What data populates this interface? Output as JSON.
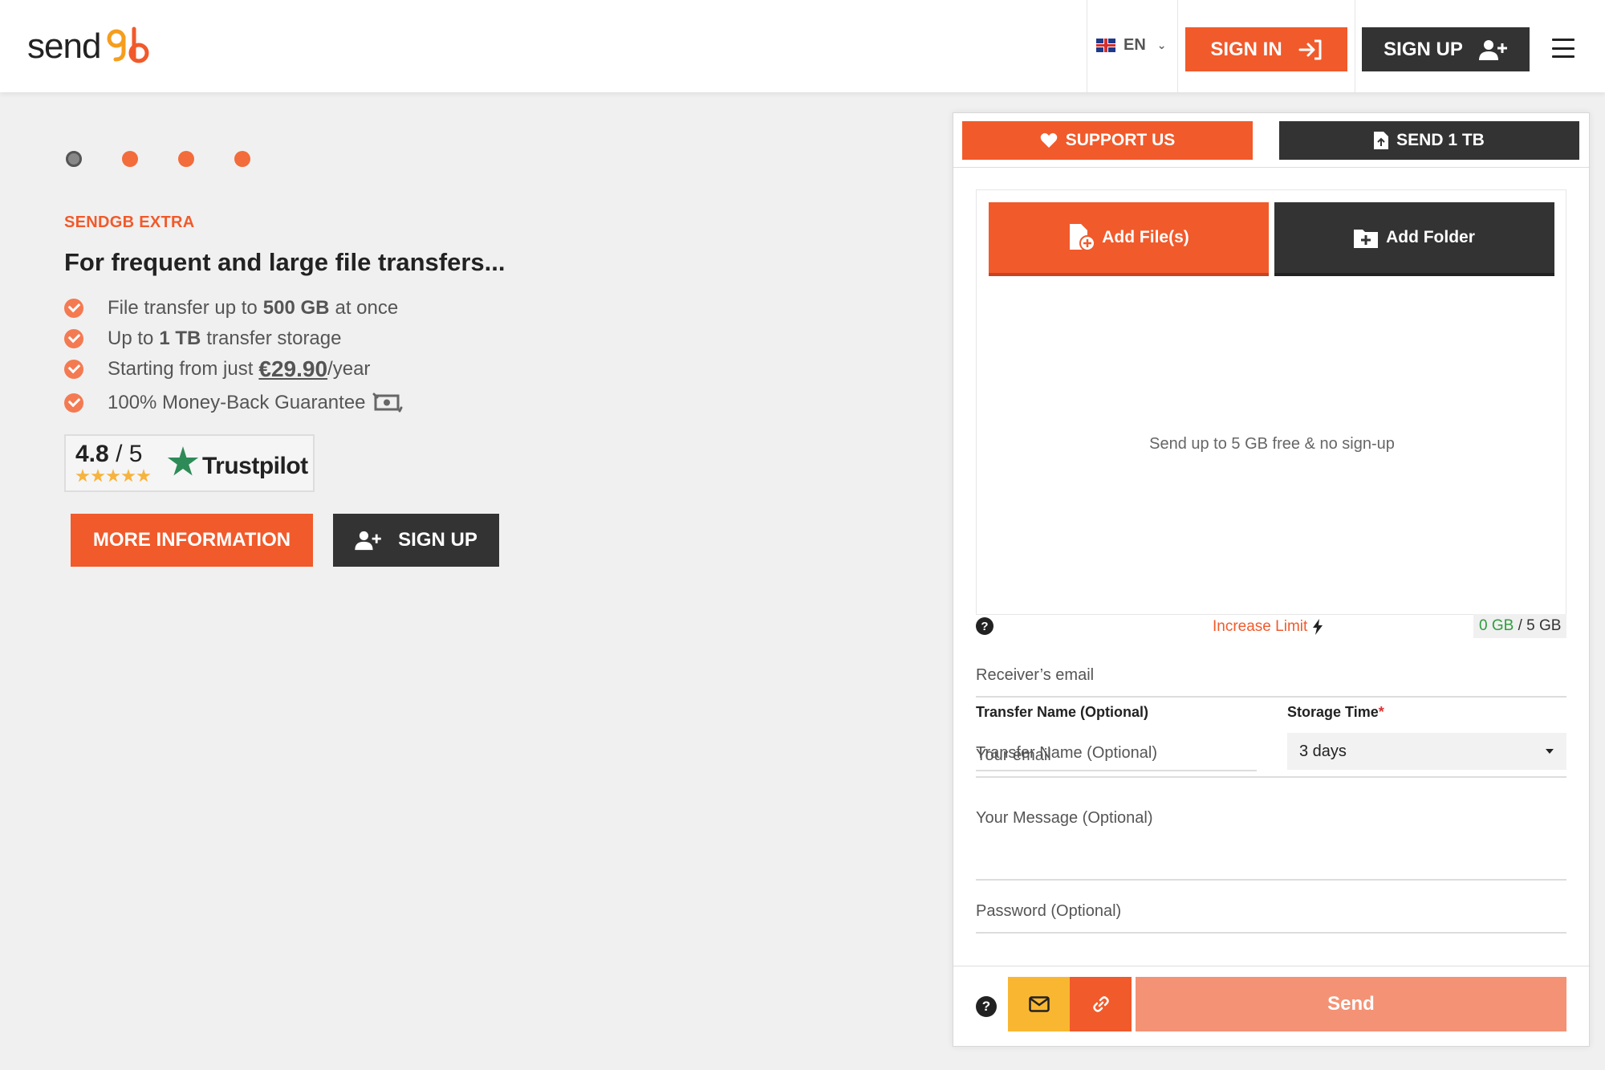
{
  "header": {
    "logo_text": "send",
    "language": "EN",
    "sign_in_label": "SIGN IN",
    "sign_up_label": "SIGN UP"
  },
  "hero": {
    "eyebrow": "SENDGB EXTRA",
    "headline": "For frequent and large file transfers...",
    "features": [
      {
        "prefix": "File transfer up to",
        "bold": "500 GB",
        "suffix": "at once"
      },
      {
        "prefix": "Up to",
        "bold": "1 TB",
        "suffix": "transfer storage"
      },
      {
        "prefix": "Starting from just",
        "bold": "€29.90",
        "suffix": "/year"
      },
      {
        "prefix": "100% Money-Back Guarantee",
        "bold": "",
        "suffix": ""
      }
    ],
    "rating_value": "4.8",
    "rating_scale": "/ 5",
    "rating_brand": "Trustpilot",
    "more_info_label": "MORE INFORMATION",
    "sign_up_label": "SIGN UP",
    "slide_count": 4,
    "active_slide": 1
  },
  "panel": {
    "support_label": "SUPPORT US",
    "send1tb_label": "SEND 1 TB",
    "add_files_label": "Add File(s)",
    "add_folder_label": "Add Folder",
    "drop_hint": "Send up to 5 GB free & no sign-up",
    "increase_limit": "Increase Limit",
    "quota_used": "0 GB",
    "quota_total": "/ 5 GB",
    "receiver_placeholder": "Receiver’s email",
    "your_email_placeholder": "Your email",
    "transfer_name_label": "Transfer Name (Optional)",
    "transfer_name_placeholder": "Transfer Name (Optional)",
    "storage_time_label": "Storage Time",
    "storage_time_required": "*",
    "storage_time_value": "3 days",
    "message_placeholder": "Your Message  (Optional)",
    "password_placeholder": "Password (Optional)",
    "send_label": "Send",
    "help_symbol": "?"
  },
  "colors": {
    "accent": "#f15a2b",
    "dark": "#333333",
    "mail_button": "#f9b731",
    "send_disabled": "#f49275",
    "quota_used": "#2e9e3e"
  }
}
